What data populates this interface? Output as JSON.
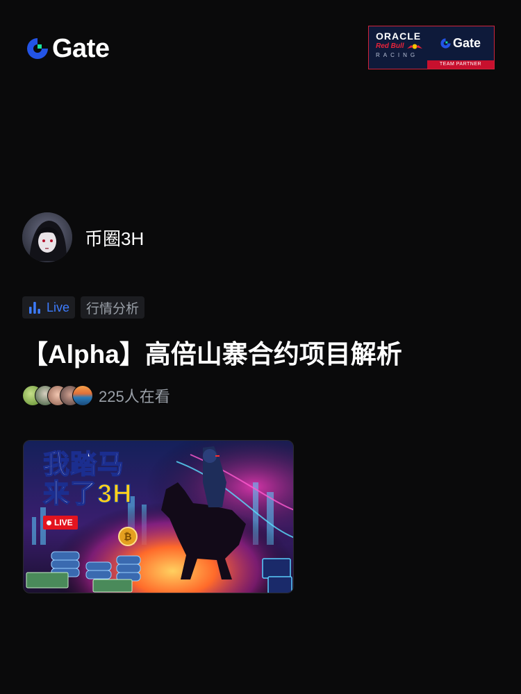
{
  "header": {
    "brand": "Gate",
    "brand_color": "#2354e6",
    "partner": {
      "oracle": "ORACLE",
      "redbull": "Red Bull",
      "racing": "RACING",
      "gate": "Gate",
      "team_partner": "TEAM PARTNER"
    }
  },
  "host": {
    "name": "币圈3H",
    "avatar_icon": "anime-avatar"
  },
  "tags": {
    "live_label": "Live",
    "live_icon": "bar-chart-icon",
    "live_color": "#3d7cff",
    "category": "行情分析"
  },
  "stream": {
    "title": "【Alpha】高倍山寨合约项目解析",
    "viewers": "225人在看"
  },
  "thumbnail": {
    "line1": "我踏马",
    "line2_prefix": "来了",
    "line2_highlight": "3H",
    "live_badge": "LIVE"
  }
}
